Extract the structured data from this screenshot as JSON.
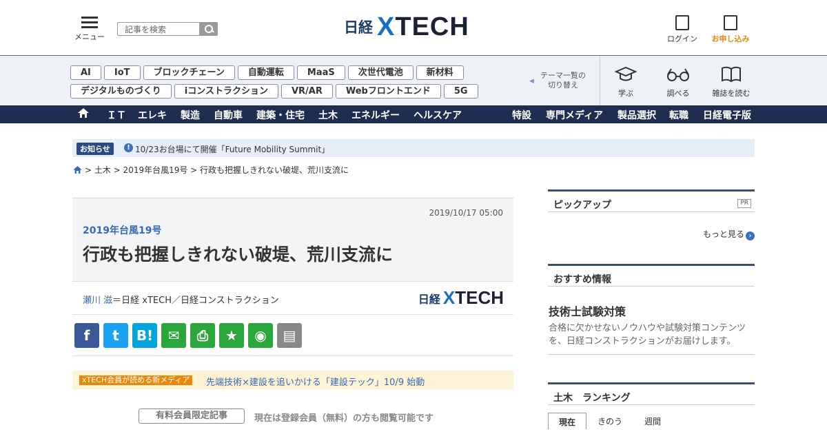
{
  "header": {
    "menu_label": "メニュー",
    "search_placeholder": "記事を検索",
    "logo_nikkei": "日経",
    "logo_x": "X",
    "logo_tech": "TECH",
    "login_label": "ログイン",
    "apply_label": "お申し込み"
  },
  "topics": {
    "tags_row1": [
      "AI",
      "IoT",
      "ブロックチェーン",
      "自動運転",
      "MaaS",
      "次世代電池",
      "新材料"
    ],
    "tags_row2": [
      "デジタルものづくり",
      "iコンストラクション",
      "VR/AR",
      "Webフロントエンド",
      "5G"
    ],
    "switch_line1": "テーマ一覧の",
    "switch_line2": "切り替え",
    "tools": [
      "学ぶ",
      "調べる",
      "雑誌を読む"
    ]
  },
  "nav": {
    "left": [
      "ＩＴ",
      "エレキ",
      "製造",
      "自動車",
      "建築・住宅",
      "土木",
      "エネルギー",
      "ヘルスケア"
    ],
    "right": [
      "特設",
      "専門メディア",
      "製品選択",
      "転職",
      "日経電子版"
    ]
  },
  "notice": {
    "badge": "お知らせ",
    "text": "10/23お台場にて開催「Future Mobility Summit」"
  },
  "breadcrumb": "> 土木 > 2019年台風19号 > 行政も把握しきれない破堤、荒川支流に",
  "article": {
    "date": "2019/10/17 05:00",
    "series": "2019年台風19号",
    "title": "行政も把握しきれない破堤、荒川支流に",
    "author": "瀬川 滋",
    "affiliation": "＝日経 xTECH／日経コンストラクション",
    "logo_nikkei": "日経",
    "logo_x": "X",
    "logo_tech": "TECH"
  },
  "share_buttons": [
    {
      "name": "facebook",
      "glyph": "f",
      "color": "#3b5998"
    },
    {
      "name": "twitter",
      "glyph": "t",
      "color": "#1da1f2"
    },
    {
      "name": "hatena",
      "glyph": "B!",
      "color": "#00a4de"
    },
    {
      "name": "mail",
      "glyph": "✉",
      "color": "#2aa63a"
    },
    {
      "name": "print",
      "glyph": "⎙",
      "color": "#2aa63a"
    },
    {
      "name": "favorite",
      "glyph": "★",
      "color": "#2aa63a"
    },
    {
      "name": "watch",
      "glyph": "◉",
      "color": "#2aa63a"
    },
    {
      "name": "memo",
      "glyph": "▤",
      "color": "#888888"
    }
  ],
  "promo": {
    "badge": "xTECH会員が読める新メディア",
    "text": "先端技術×建設を追いかける「建設テック」10/9 始動"
  },
  "paywall": {
    "badge": "有料会員限定記事",
    "note": "現在は登録会員（無料）の方も閲覧可能です"
  },
  "sidebar": {
    "pickup_title": "ピックアップ",
    "pr_label": "PR",
    "more_label": "もっと見る",
    "recommend_title": "おすすめ情報",
    "rec_item_title": "技術士試験対策",
    "rec_item_desc": "合格に欠かせないノウハウや試験対策コンテンツを、日経コンストラクションがお届けします。",
    "ranking_title": "土木　ランキング",
    "ranking_tabs": [
      "現在",
      "きのう",
      "週間"
    ]
  }
}
